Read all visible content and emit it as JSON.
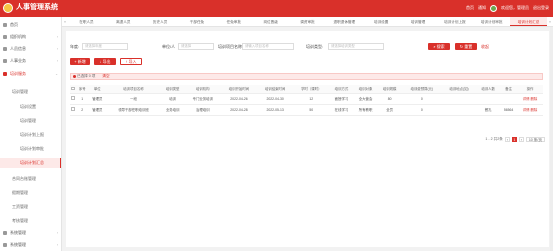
{
  "app": {
    "title": "人事管理系统"
  },
  "topbar": {
    "home": "首页",
    "notice": "通知",
    "welcome": "欢迎您，管理员",
    "exit": "退出登录"
  },
  "sidebar": {
    "items": [
      {
        "label": "首页",
        "icon": "home-icon"
      },
      {
        "label": "组织机构",
        "icon": "org-icon"
      },
      {
        "label": "人员信息",
        "icon": "people-icon"
      },
      {
        "label": "人事业务",
        "icon": "briefcase-icon"
      },
      {
        "label": "培训服务",
        "icon": "training-icon"
      }
    ],
    "group": "培训管理",
    "subs": [
      "培训设置",
      "培训管理",
      "培训计划上报",
      "培训计划审批",
      "培训计划汇总"
    ],
    "after": [
      "合同台账管理",
      "假期管理",
      "工资管理",
      "考核管理"
    ],
    "bottom": [
      {
        "label": "系统管理",
        "icon": "settings-icon"
      },
      {
        "label": "系统管理",
        "icon": "settings-icon"
      }
    ]
  },
  "tabs": [
    "在职人员",
    "离退人员",
    "历史人员",
    "干部任免",
    "任免审批",
    "岗位晋级",
    "调资审批",
    "退职退休管理",
    "培训设置",
    "培训管理",
    "培训计划上报",
    "培训计划审批",
    "培训计划汇总"
  ],
  "filters": {
    "year_label": "年度:",
    "year_placeholder": "请选择年度",
    "unit_label": "单位/人",
    "unit_placeholder": "请选择",
    "project_label": "培训项目名称:",
    "project_placeholder": "请输入项目名称",
    "type_label": "培训类型:",
    "type_placeholder": "请选择培训类型",
    "search": "搜索",
    "reset": "重置",
    "expand": "收起"
  },
  "actions": {
    "add": "新增",
    "export": "导出",
    "import": "导入"
  },
  "alert": {
    "text": "已选择 0 项",
    "clear": "清空"
  },
  "table": {
    "headers": [
      "序号",
      "单位",
      "培训项目名称",
      "培训类型",
      "培训机构",
      "培训开始时间",
      "培训结束时间",
      "学时（课时）",
      "培训方式",
      "培训对象",
      "培训规模",
      "培训费预算(元)",
      "培训地点(如)",
      "培训人数",
      "备注",
      "操作"
    ],
    "rows": [
      [
        "1",
        "管理员",
        "一段",
        "培训",
        "专门业务培训",
        "2022-04-26",
        "2022-04-30",
        "12",
        "面授学习",
        "全大营会",
        "80",
        "0",
        "",
        "",
        "",
        "详情 删除"
      ],
      [
        "2",
        "管理员",
        "领导干部任职培训班",
        "业务培训",
        "治理培训",
        "2022-04-28",
        "2022-05-13",
        "50",
        "在线学习",
        "所有教职",
        "全员",
        "0",
        "",
        "餐孔",
        "56564",
        "详情 删除"
      ]
    ]
  },
  "pager": {
    "total": "1 - 2 共2条",
    "page": "1",
    "size": "10 条/页"
  },
  "colors": {
    "primary": "#d9302a"
  }
}
